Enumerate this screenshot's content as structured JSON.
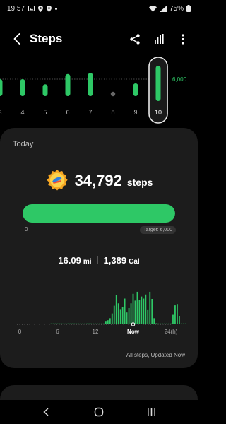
{
  "status": {
    "time": "19:57",
    "battery": "75%",
    "icons": [
      "photo-icon",
      "location-icon",
      "location-icon",
      "dot-icon",
      "wifi-icon",
      "signal-icon",
      "battery-icon"
    ]
  },
  "header": {
    "title": "Steps",
    "icons": [
      "back-icon",
      "share-icon",
      "bar-chart-icon",
      "more-icon"
    ]
  },
  "week": {
    "target_label": "6,000",
    "colors": {
      "bar": "#2ec866",
      "selected_outline": "#e8e8e8",
      "empty_dot": "#666"
    }
  },
  "today": {
    "label": "Today",
    "steps_value": "34,792",
    "steps_unit": "steps",
    "progress": {
      "fraction": 1.0,
      "min_label": "0",
      "target_label": "Target: 6,000"
    },
    "distance_value": "16.09",
    "distance_unit": "mi",
    "calories_value": "1,389",
    "calories_unit": "Cal",
    "footer": "All steps, Updated Now"
  },
  "chart_data": [
    {
      "type": "bar",
      "title": "",
      "categories": [
        "3",
        "4",
        "5",
        "6",
        "7",
        "8",
        "9",
        "10"
      ],
      "values": [
        6000,
        6000,
        4200,
        7800,
        8200,
        0,
        4500,
        34792
      ],
      "selected": "10",
      "reference_line": {
        "value": 6000,
        "label": "6,000"
      },
      "ylim": [
        0,
        14000
      ],
      "grid": false
    },
    {
      "type": "bar",
      "title": "",
      "xlabel": "",
      "ylabel": "",
      "x_tick_labels": [
        "0",
        "6",
        "12",
        "Now",
        "24(h)"
      ],
      "x": [
        15,
        16,
        17,
        18,
        19,
        20,
        21,
        22,
        23,
        24,
        25,
        26,
        27,
        28,
        29,
        30,
        31,
        32,
        33,
        34,
        35,
        36,
        37,
        38,
        39,
        40,
        41,
        42,
        43,
        44,
        45,
        46,
        47,
        48,
        49,
        50,
        51,
        52,
        53,
        54,
        55,
        56,
        57,
        58,
        59,
        60,
        61,
        62,
        63,
        64,
        65,
        66,
        67,
        68,
        69,
        70,
        71,
        72,
        73,
        74,
        75,
        76,
        77,
        78,
        79
      ],
      "values": [
        5,
        5,
        5,
        5,
        5,
        5,
        5,
        5,
        5,
        5,
        5,
        5,
        5,
        5,
        5,
        5,
        5,
        5,
        5,
        5,
        5,
        5,
        5,
        5,
        5,
        5,
        100,
        120,
        180,
        320,
        550,
        860,
        620,
        450,
        520,
        760,
        350,
        480,
        620,
        900,
        700,
        960,
        720,
        820,
        760,
        880,
        440,
        960,
        750,
        180,
        30,
        10,
        5,
        5,
        5,
        5,
        5,
        5,
        280,
        560,
        600,
        250,
        5,
        5,
        5
      ],
      "bar_unit_minutes": 20,
      "ylim": [
        0,
        1000
      ],
      "grid": false
    }
  ]
}
